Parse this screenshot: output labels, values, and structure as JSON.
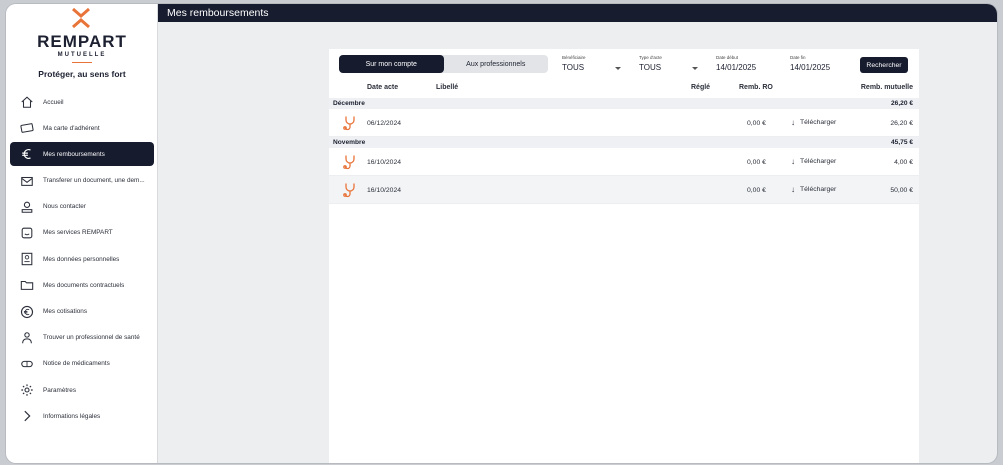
{
  "brand": {
    "name": "REMPART",
    "sub": "MUTUELLE",
    "tagline": "Protéger, au sens fort"
  },
  "sidebar": {
    "items": [
      {
        "label": "Accueil",
        "icon": "home-icon",
        "active": false
      },
      {
        "label": "Ma carte d'adhérent",
        "icon": "card-icon",
        "active": false
      },
      {
        "label": "Mes remboursements",
        "icon": "euro-icon",
        "active": true
      },
      {
        "label": "Transferer un document, une dem...",
        "icon": "mail-icon",
        "active": false
      },
      {
        "label": "Nous contacter",
        "icon": "contact-icon",
        "active": false
      },
      {
        "label": "Mes services REMPART",
        "icon": "services-icon",
        "active": false
      },
      {
        "label": "Mes données personnelles",
        "icon": "id-icon",
        "active": false
      },
      {
        "label": "Mes documents contractuels",
        "icon": "folder-icon",
        "active": false
      },
      {
        "label": "Mes cotisations",
        "icon": "euro-circle-icon",
        "active": false
      },
      {
        "label": "Trouver un professionnel de santé",
        "icon": "doctor-icon",
        "active": false
      },
      {
        "label": "Notice de médicaments",
        "icon": "pill-icon",
        "active": false
      },
      {
        "label": "Paramètres",
        "icon": "gear-icon",
        "active": false
      },
      {
        "label": "Informations légales",
        "icon": "chevron-right-icon",
        "active": false
      }
    ]
  },
  "header": {
    "title": "Mes remboursements"
  },
  "tabs": [
    {
      "label": "Sur mon compte",
      "active": true
    },
    {
      "label": "Aux professionnels",
      "active": false
    }
  ],
  "filters": {
    "beneficiaire": {
      "label": "Bénéficiaire",
      "value": "TOUS"
    },
    "type_acte": {
      "label": "Type d'acte",
      "value": "TOUS"
    },
    "date_debut": {
      "label": "Date début",
      "value": "14/01/2025"
    },
    "date_fin": {
      "label": "Date fin",
      "value": "14/01/2025"
    },
    "search_label": "Rechercher"
  },
  "table": {
    "headers": {
      "date": "Date acte",
      "libelle": "Libellé",
      "regle": "Réglé",
      "ro": "Remb. RO",
      "mutuelle": "Remb. mutuelle"
    },
    "groups": [
      {
        "name": "Décembre",
        "total": "26,20 €",
        "rows": [
          {
            "date": "06/12/2024",
            "ro": "0,00 €",
            "download": "Télécharger",
            "mutuelle": "26,20 €"
          }
        ]
      },
      {
        "name": "Novembre",
        "total": "45,75 €",
        "rows": [
          {
            "date": "16/10/2024",
            "ro": "0,00 €",
            "download": "Télécharger",
            "mutuelle": "4,00 €"
          },
          {
            "date": "16/10/2024",
            "ro": "0,00 €",
            "download": "Télécharger",
            "mutuelle": "50,00 €"
          }
        ]
      }
    ]
  },
  "colors": {
    "navy": "#161b2e",
    "accent": "#e8743a"
  }
}
